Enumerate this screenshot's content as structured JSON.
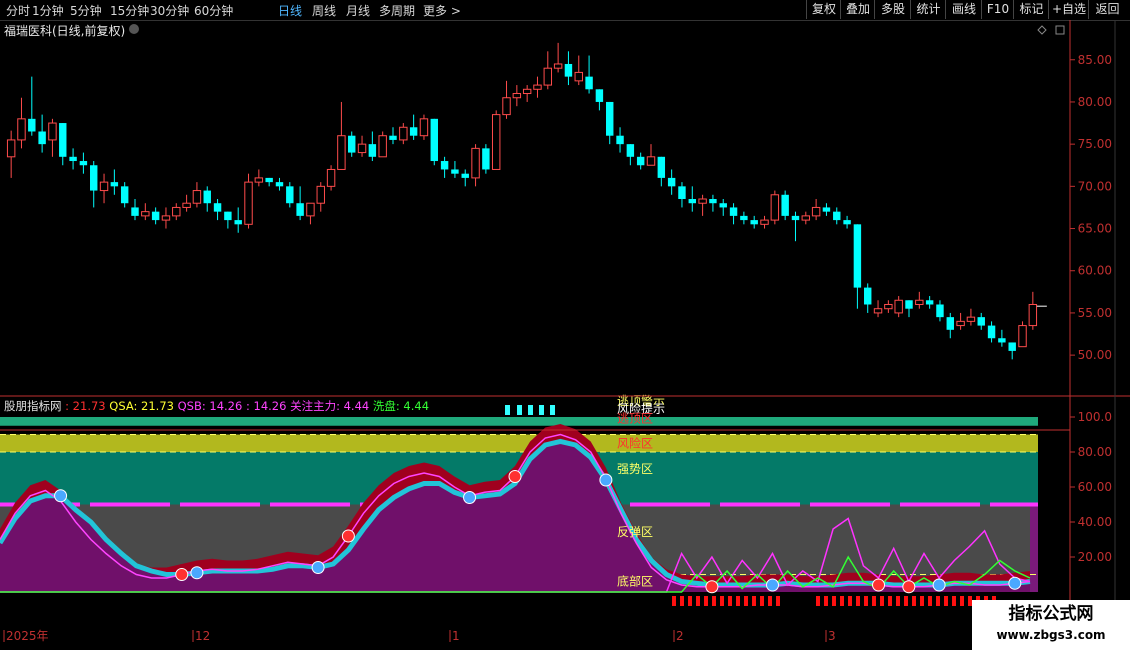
{
  "toolbar": {
    "periods": [
      "分时",
      "1分钟",
      "5分钟",
      "15分钟",
      "30分钟",
      "60分钟",
      "日线",
      "周线",
      "月线",
      "多周期",
      "更多 >"
    ],
    "active_period": "日线",
    "right_buttons": [
      "复权",
      "叠加",
      "多股",
      "统计",
      "画线",
      "F10",
      "标记",
      "+自选",
      "返回"
    ]
  },
  "stock": {
    "title": "福瑞医科(日线,前复权)"
  },
  "indicator": {
    "name": "股朋指标网",
    "value1": ": 21.73",
    "qsa": "QSA: 21.73",
    "qsb": "QSB: 14.26",
    "value2": ": 14.26",
    "main_force": "关注主力: 4.44",
    "wash": "洗盘: 4.44",
    "zones": [
      "逃顶警示",
      "风险提示",
      "逃顶区",
      "风险区",
      "强势区",
      "反弹区",
      "底部区"
    ]
  },
  "colors": {
    "up": "#ff4c4c",
    "down": "#00ffff",
    "axis": "#c03030"
  },
  "watermark": {
    "title": "指标公式网",
    "url": "www.zbgs3.com"
  },
  "chart_data": [
    {
      "type": "candlestick",
      "title": "福瑞医科(日线,前复权)",
      "y_ticks": [
        "85.00",
        "80.00",
        "75.00",
        "70.00",
        "65.00",
        "60.00",
        "55.00",
        "50.00"
      ],
      "ylim": [
        48,
        89
      ],
      "x_ticks": [
        "2025年",
        "12",
        "1",
        "2",
        "3"
      ],
      "candles": [
        [
          73.5,
          76.6,
          71.0,
          75.5
        ],
        [
          75.5,
          80.5,
          74.5,
          78.0
        ],
        [
          78.0,
          83.0,
          76.0,
          76.5
        ],
        [
          76.5,
          78.5,
          74.0,
          75.0
        ],
        [
          75.5,
          78.0,
          73.5,
          77.5
        ],
        [
          77.5,
          77.5,
          72.5,
          73.5
        ],
        [
          73.5,
          74.5,
          72.0,
          73.0
        ],
        [
          73.0,
          74.0,
          71.5,
          72.5
        ],
        [
          72.5,
          73.0,
          67.5,
          69.5
        ],
        [
          69.5,
          71.5,
          68.0,
          70.5
        ],
        [
          70.5,
          72.0,
          69.0,
          70.0
        ],
        [
          70.0,
          70.5,
          67.5,
          68.0
        ],
        [
          67.5,
          68.5,
          66.0,
          66.5
        ],
        [
          66.5,
          68.0,
          66.0,
          67.0
        ],
        [
          67.0,
          67.5,
          65.5,
          66.0
        ],
        [
          66.0,
          67.5,
          65.0,
          66.5
        ],
        [
          66.5,
          68.0,
          66.0,
          67.5
        ],
        [
          67.5,
          69.0,
          67.0,
          68.0
        ],
        [
          68.0,
          70.5,
          67.5,
          69.5
        ],
        [
          69.5,
          70.0,
          67.0,
          68.0
        ],
        [
          68.0,
          68.5,
          66.0,
          67.0
        ],
        [
          67.0,
          67.0,
          65.0,
          66.0
        ],
        [
          66.0,
          67.5,
          64.5,
          65.5
        ],
        [
          65.5,
          71.5,
          65.0,
          70.5
        ],
        [
          70.5,
          72.0,
          70.0,
          71.0
        ],
        [
          71.0,
          71.0,
          70.0,
          70.5
        ],
        [
          70.5,
          71.0,
          69.5,
          70.0
        ],
        [
          70.0,
          70.5,
          67.5,
          68.0
        ],
        [
          68.0,
          70.0,
          66.0,
          66.5
        ],
        [
          66.5,
          68.0,
          65.5,
          68.0
        ],
        [
          68.0,
          70.5,
          67.0,
          70.0
        ],
        [
          70.0,
          72.5,
          69.5,
          72.0
        ],
        [
          72.0,
          80.0,
          72.0,
          76.0
        ],
        [
          76.0,
          76.5,
          73.5,
          74.0
        ],
        [
          74.0,
          76.0,
          73.5,
          75.0
        ],
        [
          75.0,
          76.5,
          73.0,
          73.5
        ],
        [
          73.5,
          76.5,
          73.5,
          76.0
        ],
        [
          76.0,
          77.0,
          75.0,
          75.5
        ],
        [
          75.5,
          77.5,
          75.0,
          77.0
        ],
        [
          77.0,
          78.5,
          75.5,
          76.0
        ],
        [
          76.0,
          78.5,
          75.5,
          78.0
        ],
        [
          78.0,
          78.0,
          72.5,
          73.0
        ],
        [
          73.0,
          73.5,
          71.0,
          72.0
        ],
        [
          72.0,
          73.0,
          71.0,
          71.5
        ],
        [
          71.5,
          72.0,
          70.0,
          71.0
        ],
        [
          71.0,
          75.0,
          70.0,
          74.5
        ],
        [
          74.5,
          75.0,
          71.5,
          72.0
        ],
        [
          72.0,
          79.0,
          72.0,
          78.5
        ],
        [
          78.5,
          82.5,
          78.0,
          80.5
        ],
        [
          80.5,
          82.0,
          79.5,
          81.0
        ],
        [
          81.0,
          82.0,
          80.0,
          81.5
        ],
        [
          81.5,
          83.0,
          80.5,
          82.0
        ],
        [
          82.0,
          86.0,
          81.5,
          84.0
        ],
        [
          84.0,
          87.0,
          83.5,
          84.5
        ],
        [
          84.5,
          86.0,
          82.0,
          83.0
        ],
        [
          82.5,
          85.5,
          82.0,
          83.5
        ],
        [
          83.0,
          85.5,
          81.0,
          81.5
        ],
        [
          81.5,
          81.5,
          79.0,
          80.0
        ],
        [
          80.0,
          80.0,
          75.0,
          76.0
        ],
        [
          76.0,
          77.0,
          74.0,
          75.0
        ],
        [
          75.0,
          75.0,
          72.5,
          73.5
        ],
        [
          73.5,
          74.0,
          72.0,
          72.5
        ],
        [
          72.5,
          75.0,
          72.5,
          73.5
        ],
        [
          73.5,
          73.5,
          70.0,
          71.0
        ],
        [
          71.0,
          72.0,
          69.0,
          70.0
        ],
        [
          70.0,
          70.5,
          67.5,
          68.5
        ],
        [
          68.5,
          70.0,
          67.0,
          68.0
        ],
        [
          68.0,
          69.0,
          66.5,
          68.5
        ],
        [
          68.5,
          69.0,
          67.0,
          68.0
        ],
        [
          68.0,
          68.5,
          66.5,
          67.5
        ],
        [
          67.5,
          68.0,
          65.5,
          66.5
        ],
        [
          66.5,
          67.0,
          65.5,
          66.0
        ],
        [
          66.0,
          66.5,
          65.0,
          65.5
        ],
        [
          65.5,
          66.5,
          65.0,
          66.0
        ],
        [
          66.0,
          69.5,
          65.5,
          69.0
        ],
        [
          69.0,
          69.5,
          66.0,
          66.5
        ],
        [
          66.5,
          67.0,
          63.5,
          66.0
        ],
        [
          66.0,
          67.0,
          65.5,
          66.5
        ],
        [
          66.5,
          68.5,
          66.0,
          67.5
        ],
        [
          67.5,
          68.0,
          66.5,
          67.0
        ],
        [
          67.0,
          67.5,
          65.5,
          66.0
        ],
        [
          66.0,
          66.5,
          65.0,
          65.5
        ],
        [
          65.5,
          65.5,
          55.5,
          58.0
        ],
        [
          58.0,
          58.5,
          55.0,
          56.0
        ],
        [
          55.0,
          56.5,
          54.5,
          55.5
        ],
        [
          55.5,
          56.5,
          55.0,
          56.0
        ],
        [
          55.0,
          57.0,
          54.5,
          56.5
        ],
        [
          56.5,
          56.5,
          54.5,
          55.5
        ],
        [
          56.0,
          57.5,
          55.5,
          56.5
        ],
        [
          56.5,
          57.0,
          55.5,
          56.0
        ],
        [
          56.0,
          56.5,
          54.0,
          54.5
        ],
        [
          54.5,
          55.0,
          52.0,
          53.0
        ],
        [
          53.5,
          55.0,
          53.0,
          54.0
        ],
        [
          54.0,
          55.5,
          53.5,
          54.5
        ],
        [
          54.5,
          55.0,
          53.0,
          53.5
        ],
        [
          53.5,
          54.0,
          51.5,
          52.0
        ],
        [
          52.0,
          53.0,
          51.0,
          51.5
        ],
        [
          51.5,
          51.5,
          49.5,
          50.5
        ],
        [
          51.0,
          54.0,
          51.0,
          53.5
        ],
        [
          53.5,
          57.5,
          53.0,
          56.0
        ]
      ],
      "last_price": 55.8
    },
    {
      "type": "area",
      "title": "股朋指标网",
      "y_ticks": [
        "100.0",
        "80.00",
        "60.00",
        "40.00",
        "20.00"
      ],
      "ylim": [
        0,
        105
      ],
      "zone_bands": [
        {
          "name": "逃顶区",
          "from": 95,
          "to": 100,
          "color": "#1fa97c"
        },
        {
          "name": "风险区",
          "from": 80,
          "to": 90,
          "color": "#b2b81e"
        },
        {
          "name": "强势区",
          "from": 50,
          "to": 80,
          "color": "#047a68"
        },
        {
          "name": "反弹区",
          "from": 10,
          "to": 50,
          "color": "#4a4a4a"
        },
        {
          "name": "底部区",
          "from": 0,
          "to": 10,
          "color": "#4a4a4a"
        }
      ],
      "ref_lines": [
        90,
        80,
        50,
        10
      ],
      "series": [
        {
          "name": "QSA",
          "values": [
            30,
            45,
            55,
            58,
            52,
            40,
            30,
            22,
            15,
            10,
            8,
            8,
            10,
            12,
            13,
            12,
            12,
            13,
            15,
            17,
            16,
            15,
            20,
            32,
            45,
            55,
            62,
            66,
            68,
            66,
            60,
            55,
            57,
            58,
            66,
            80,
            88,
            90,
            87,
            80,
            65,
            45,
            28,
            14,
            7,
            4,
            3,
            3,
            3,
            3,
            4,
            4,
            4,
            3,
            3,
            4,
            5,
            5,
            4,
            3,
            3,
            3,
            4,
            5,
            5,
            4,
            4,
            5,
            6
          ]
        },
        {
          "name": "QSB",
          "values": [
            28,
            42,
            52,
            55,
            55,
            47,
            40,
            30,
            22,
            15,
            12,
            10,
            10,
            11,
            12,
            12,
            12,
            12,
            13,
            15,
            15,
            14,
            16,
            24,
            36,
            47,
            54,
            59,
            62,
            62,
            57,
            54,
            55,
            56,
            62,
            76,
            84,
            86,
            84,
            77,
            64,
            47,
            30,
            18,
            10,
            6,
            5,
            4,
            4,
            4,
            4,
            4,
            5,
            4,
            4,
            4,
            5,
            5,
            5,
            4,
            4,
            4,
            4,
            5,
            5,
            5,
            5,
            5,
            6
          ]
        },
        {
          "name": "关注主力",
          "values": [
            0,
            0,
            0,
            0,
            0,
            0,
            0,
            0,
            0,
            0,
            0,
            0,
            0,
            0,
            0,
            0,
            0,
            0,
            0,
            0,
            0,
            0,
            0,
            0,
            0,
            0,
            0,
            0,
            0,
            0,
            0,
            0,
            0,
            0,
            0,
            0,
            0,
            0,
            0,
            0,
            0,
            0,
            0,
            0,
            0,
            22,
            8,
            20,
            5,
            18,
            8,
            22,
            4,
            12,
            6,
            36,
            42,
            15,
            8,
            25,
            6,
            22,
            8,
            18,
            26,
            35,
            16,
            8,
            6
          ]
        },
        {
          "name": "洗盘",
          "values": [
            0,
            0,
            0,
            0,
            0,
            0,
            0,
            0,
            0,
            0,
            0,
            0,
            0,
            0,
            0,
            0,
            0,
            0,
            0,
            0,
            0,
            0,
            0,
            0,
            0,
            0,
            0,
            0,
            0,
            0,
            0,
            0,
            0,
            0,
            0,
            0,
            0,
            0,
            0,
            0,
            0,
            0,
            0,
            0,
            0,
            0,
            10,
            3,
            12,
            2,
            10,
            2,
            12,
            3,
            8,
            3,
            20,
            6,
            2,
            12,
            3,
            8,
            3,
            6,
            4,
            10,
            18,
            12,
            8
          ]
        }
      ]
    }
  ]
}
